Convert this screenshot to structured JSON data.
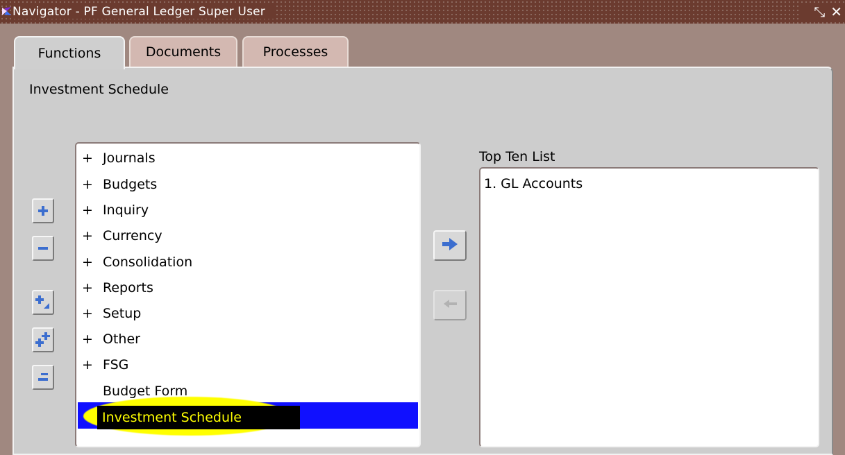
{
  "window": {
    "title": "Navigator - PF General Ledger Super User",
    "controls": {
      "minimize": "minimize-icon",
      "close": "close-icon"
    }
  },
  "tabs": [
    {
      "label": "Functions",
      "active": true
    },
    {
      "label": "Documents",
      "active": false
    },
    {
      "label": "Processes",
      "active": false
    }
  ],
  "functions": {
    "current_title": "Investment Schedule",
    "tree": [
      {
        "prefix": "+",
        "label": "Journals"
      },
      {
        "prefix": "+",
        "label": "Budgets"
      },
      {
        "prefix": "+",
        "label": "Inquiry"
      },
      {
        "prefix": "+",
        "label": "Currency"
      },
      {
        "prefix": "+",
        "label": "Consolidation"
      },
      {
        "prefix": "+",
        "label": "Reports"
      },
      {
        "prefix": "+",
        "label": "Setup"
      },
      {
        "prefix": "+",
        "label": "Other"
      },
      {
        "prefix": "+",
        "label": "FSG"
      },
      {
        "prefix": "",
        "label": "Budget Form"
      },
      {
        "prefix": "",
        "label": "Investment Schedule",
        "selected": true
      }
    ],
    "tool_buttons": [
      "expand-icon",
      "collapse-icon",
      "expand-branch-icon",
      "expand-all-icon",
      "collapse-all-icon"
    ]
  },
  "top_ten": {
    "label": "Top Ten List",
    "items": [
      "1. GL Accounts"
    ]
  },
  "colors": {
    "selection": "#1010ff",
    "highlight": "#ffff00",
    "titlebar": "#6b3b2f",
    "panel": "#cdcdcd",
    "accent_arrow": "#3c6ecf"
  }
}
